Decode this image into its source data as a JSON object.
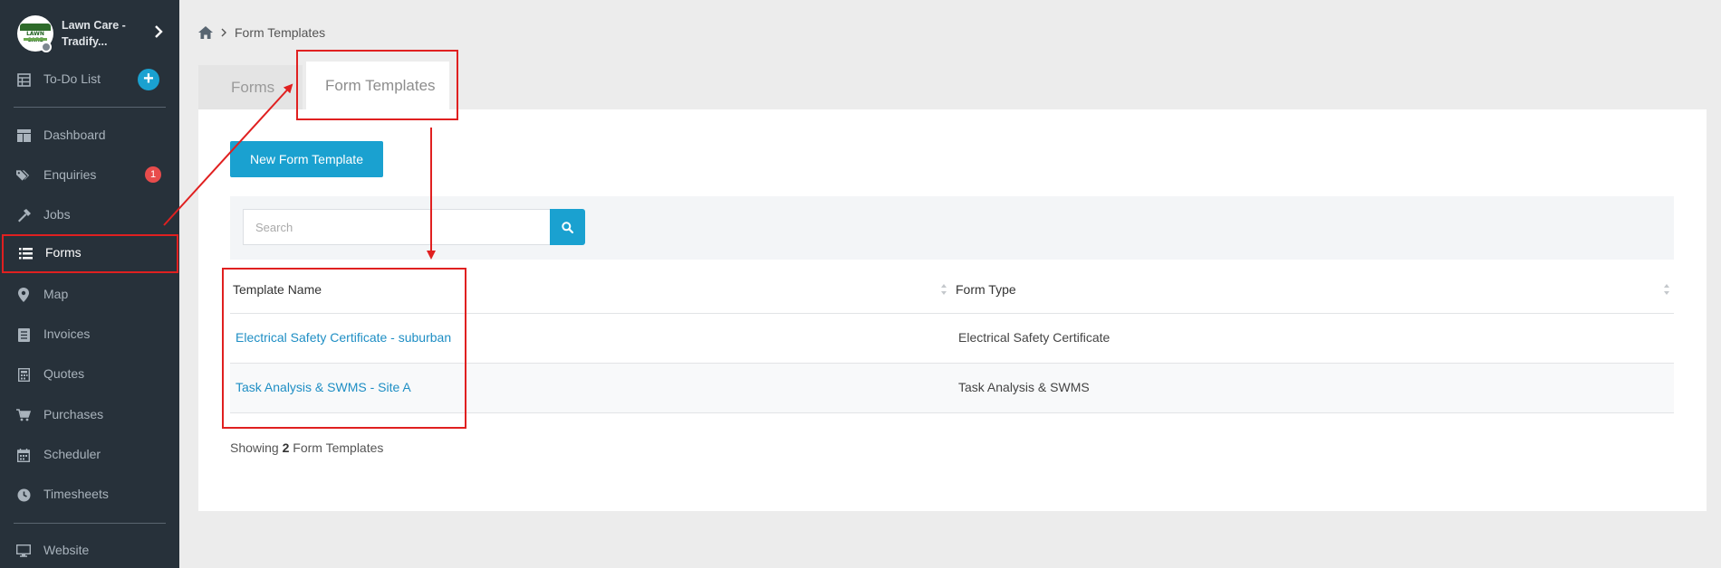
{
  "sidebar": {
    "brand": {
      "name": "Lawn Care - Tradify...",
      "logo_text": "LAWN CARE"
    },
    "todo": {
      "label": "To-Do List"
    },
    "items": [
      {
        "label": "Dashboard",
        "icon": "dashboard-icon"
      },
      {
        "label": "Enquiries",
        "icon": "tags-icon",
        "badge": "1"
      },
      {
        "label": "Jobs",
        "icon": "hammer-icon"
      },
      {
        "label": "Forms",
        "icon": "list-icon",
        "active": true
      },
      {
        "label": "Map",
        "icon": "map-pin-icon"
      },
      {
        "label": "Invoices",
        "icon": "invoice-icon"
      },
      {
        "label": "Quotes",
        "icon": "calculator-icon"
      },
      {
        "label": "Purchases",
        "icon": "cart-icon"
      },
      {
        "label": "Scheduler",
        "icon": "calendar-icon"
      },
      {
        "label": "Timesheets",
        "icon": "clock-icon"
      }
    ],
    "footer_items": [
      {
        "label": "Website",
        "icon": "monitor-icon"
      }
    ]
  },
  "breadcrumb": {
    "current": "Form Templates"
  },
  "tabs": [
    {
      "label": "Forms"
    },
    {
      "label": "Form Templates",
      "active": true
    }
  ],
  "toolbar": {
    "new_label": "New Form Template"
  },
  "search": {
    "placeholder": "Search"
  },
  "table": {
    "columns": [
      "Template Name",
      "Form Type"
    ],
    "rows": [
      {
        "name": "Electrical Safety Certificate - suburban",
        "type": "Electrical Safety Certificate"
      },
      {
        "name": "Task Analysis & SWMS - Site A",
        "type": "Task Analysis & SWMS"
      }
    ]
  },
  "footer": {
    "prefix": "Showing",
    "count": "2",
    "suffix": "Form Templates"
  },
  "colors": {
    "sidebar": "#27313a",
    "accent": "#1aa1d0",
    "highlight": "#e02020",
    "badge": "#e84c4c"
  }
}
